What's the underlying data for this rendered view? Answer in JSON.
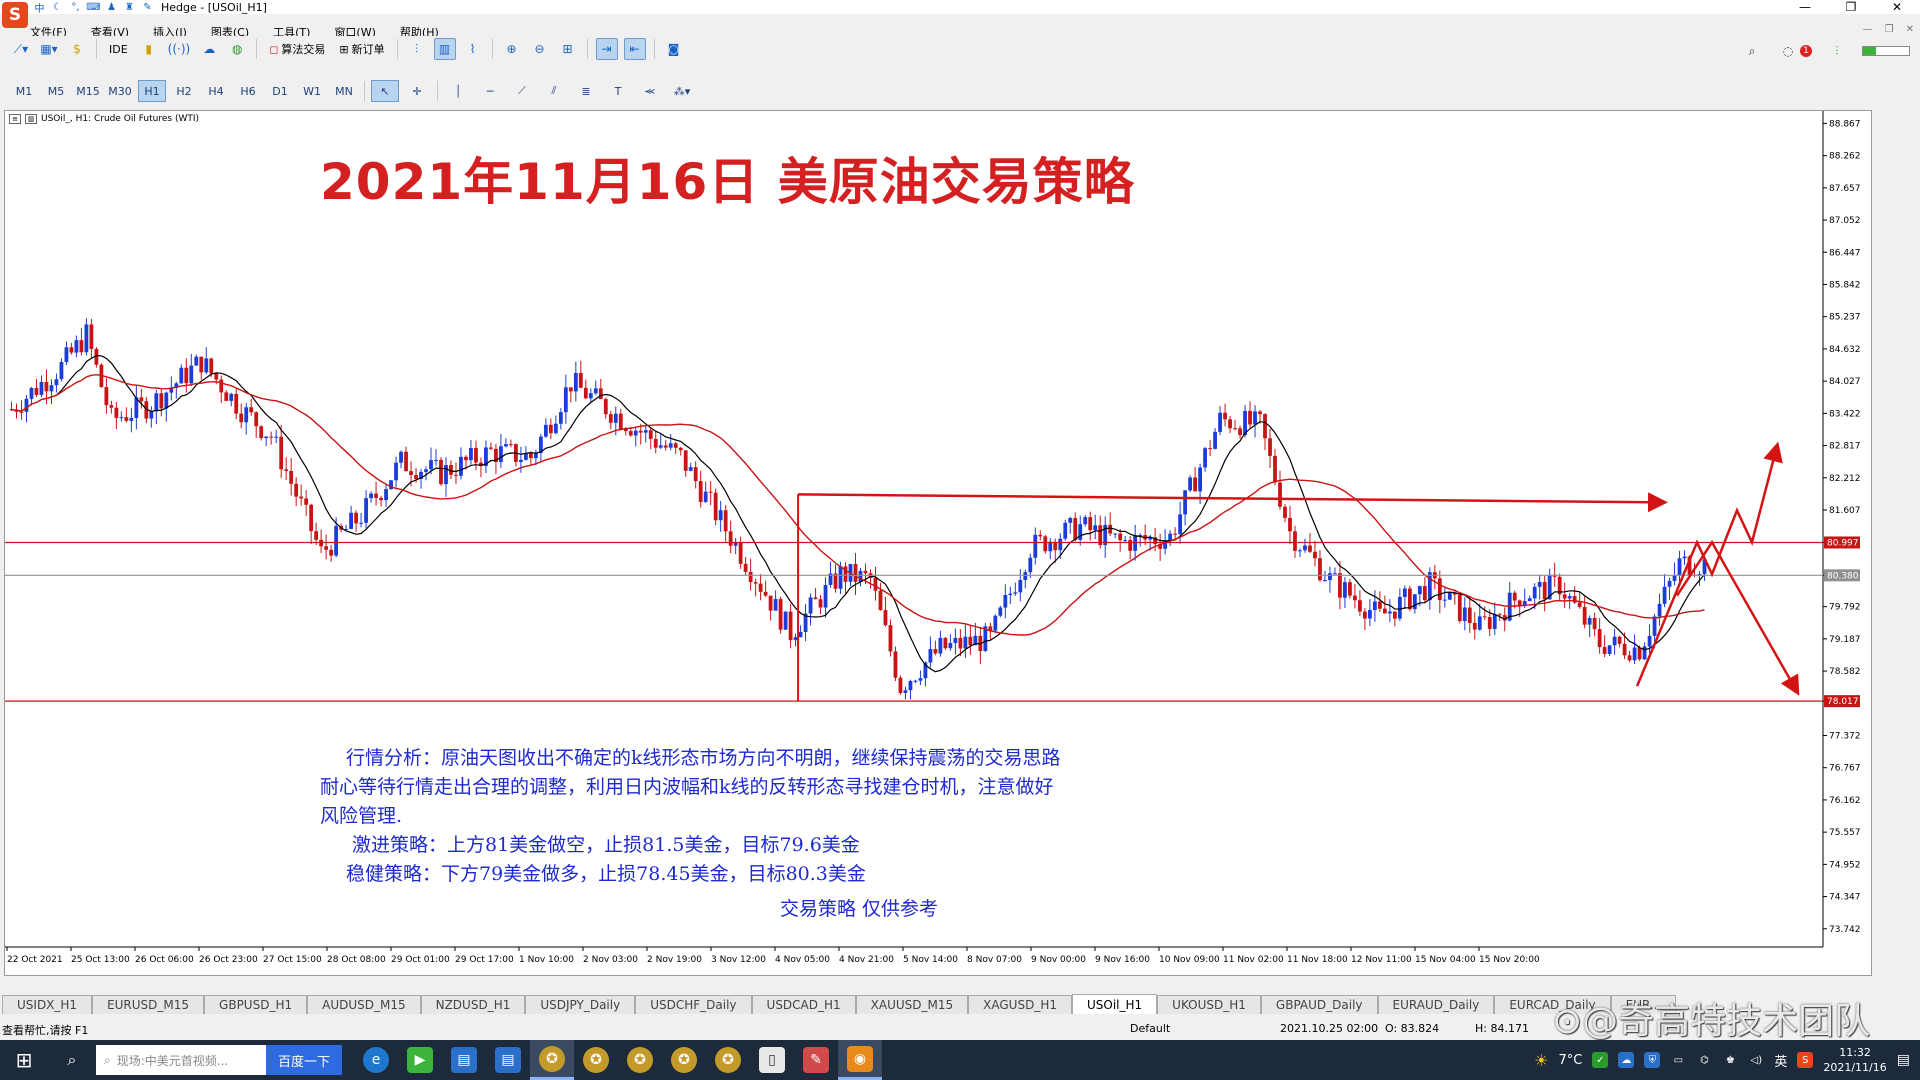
{
  "window": {
    "title": "Hedge - [USOil_H1]",
    "logo": "S",
    "ime_label": "中",
    "controls": [
      "—",
      "❐",
      "✕"
    ]
  },
  "menu": {
    "items": [
      "文件(F)",
      "查看(V)",
      "插入(I)",
      "图表(C)",
      "工具(T)",
      "窗口(W)",
      "帮助(H)"
    ]
  },
  "toolbar": {
    "ide_label": "IDE",
    "algo_label": "算法交易",
    "new_order_label": "新订单",
    "notification_count": "1",
    "battery_level": 0.28,
    "battery_color": "#3cb43c"
  },
  "timeframes": [
    "M1",
    "M5",
    "M15",
    "M30",
    "H1",
    "H2",
    "H4",
    "H6",
    "D1",
    "W1",
    "MN"
  ],
  "active_timeframe": "H1",
  "chart_header": "USOil_, H1: Crude Oil Futures (WTI)",
  "headline": "2021年11月16日  美原油交易策略",
  "analysis": {
    "line1": "行情分析：原油天图收出不确定的k线形态市场方向不明朗，继续保持震荡的交易思路",
    "line2": "耐心等待行情走出合理的调整，利用日内波幅和k线的反转形态寻找建仓时机，注意做好",
    "line3": "风险管理.",
    "aggressive": "激进策略：上方81美金做空，止损81.5美金，目标79.6美金",
    "steady": "稳健策略：下方79美金做多，止损78.45美金，目标80.3美金",
    "disclaimer": "交易策略  仅供参考"
  },
  "chart_data": {
    "type": "candlestick",
    "symbol": "USOil_",
    "timeframe": "H1",
    "ylim": [
      73.4,
      89.1
    ],
    "y_ticks": [
      "88.867",
      "88.262",
      "87.657",
      "87.052",
      "86.447",
      "85.842",
      "85.237",
      "84.632",
      "84.027",
      "83.422",
      "82.817",
      "82.212",
      "81.607",
      "80.997",
      "80.380",
      "79.792",
      "79.187",
      "78.582",
      "78.017",
      "77.372",
      "76.767",
      "76.162",
      "75.557",
      "74.952",
      "74.347",
      "73.742"
    ],
    "x_ticks": [
      "22 Oct 2021",
      "25 Oct 13:00",
      "26 Oct 06:00",
      "26 Oct 23:00",
      "27 Oct 15:00",
      "28 Oct 08:00",
      "29 Oct 01:00",
      "29 Oct 17:00",
      "1 Nov 10:00",
      "2 Nov 03:00",
      "2 Nov 19:00",
      "3 Nov 12:00",
      "4 Nov 05:00",
      "4 Nov 21:00",
      "5 Nov 14:00",
      "8 Nov 07:00",
      "9 Nov 00:00",
      "9 Nov 16:00",
      "10 Nov 09:00",
      "11 Nov 02:00",
      "11 Nov 18:00",
      "12 Nov 11:00",
      "15 Nov 04:00",
      "15 Nov 20:00"
    ],
    "price_anchors": [
      [
        0,
        83.5
      ],
      [
        10,
        84.3
      ],
      [
        15,
        84.9
      ],
      [
        20,
        83.3
      ],
      [
        28,
        83.6
      ],
      [
        38,
        84.4
      ],
      [
        46,
        83.5
      ],
      [
        52,
        83.0
      ],
      [
        62,
        80.8
      ],
      [
        70,
        81.5
      ],
      [
        78,
        82.5
      ],
      [
        86,
        82.3
      ],
      [
        96,
        82.7
      ],
      [
        104,
        82.6
      ],
      [
        112,
        84.0
      ],
      [
        124,
        83.2
      ],
      [
        134,
        82.6
      ],
      [
        146,
        80.8
      ],
      [
        156,
        79.3
      ],
      [
        166,
        80.4
      ],
      [
        172,
        80.3
      ],
      [
        178,
        78.3
      ],
      [
        186,
        79.0
      ],
      [
        196,
        79.2
      ],
      [
        204,
        80.9
      ],
      [
        214,
        81.3
      ],
      [
        222,
        81.0
      ],
      [
        232,
        81.1
      ],
      [
        242,
        83.3
      ],
      [
        250,
        83.2
      ],
      [
        256,
        81.2
      ],
      [
        264,
        80.3
      ],
      [
        274,
        79.6
      ],
      [
        284,
        80.2
      ],
      [
        294,
        79.4
      ],
      [
        302,
        80.0
      ],
      [
        310,
        80.2
      ],
      [
        318,
        79.1
      ],
      [
        326,
        79.0
      ],
      [
        334,
        80.6
      ]
    ],
    "levels": [
      {
        "price": 80.997,
        "label": "80.997",
        "color": "#c81414",
        "style": "solid"
      },
      {
        "price": 80.38,
        "label": "80.380",
        "color": "#909090",
        "style": "solid"
      },
      {
        "price": 78.017,
        "label": "78.017",
        "color": "#c81414",
        "style": "solid"
      }
    ],
    "bull_color": "#1a3cd8",
    "bear_color": "#c81414",
    "ma_fast_color": "#000000",
    "ma_slow_color": "#c81414",
    "resistance_start": 81.9,
    "resistance_end": 81.75,
    "projection_color": "#d41414"
  },
  "symbol_tabs": [
    "USIDX_H1",
    "EURUSD_M15",
    "GBPUSD_H1",
    "AUDUSD_M15",
    "NZDUSD_H1",
    "USDJPY_Daily",
    "USDCHF_Daily",
    "USDCAD_H1",
    "XAUUSD_M15",
    "XAGUSD_H1",
    "USOil_H1",
    "UKOUSD_H1",
    "GBPAUD_Daily",
    "EURAUD_Daily",
    "EURCAD_Daily",
    "EUR..."
  ],
  "active_tab": "USOil_H1",
  "status": {
    "help": "查看帮忙,请按 F1",
    "profile": "Default",
    "datetime": "2021.10.25 02:00",
    "open": "O: 83.824",
    "high": "H: 84.171"
  },
  "watermark": "⊙@奇高特技术团队",
  "taskbar": {
    "search_placeholder": "现场:中美元首视频...",
    "search_button": "百度一下",
    "temperature": "7°C",
    "lang": "英",
    "time": "11:32",
    "date": "2021/11/16"
  }
}
